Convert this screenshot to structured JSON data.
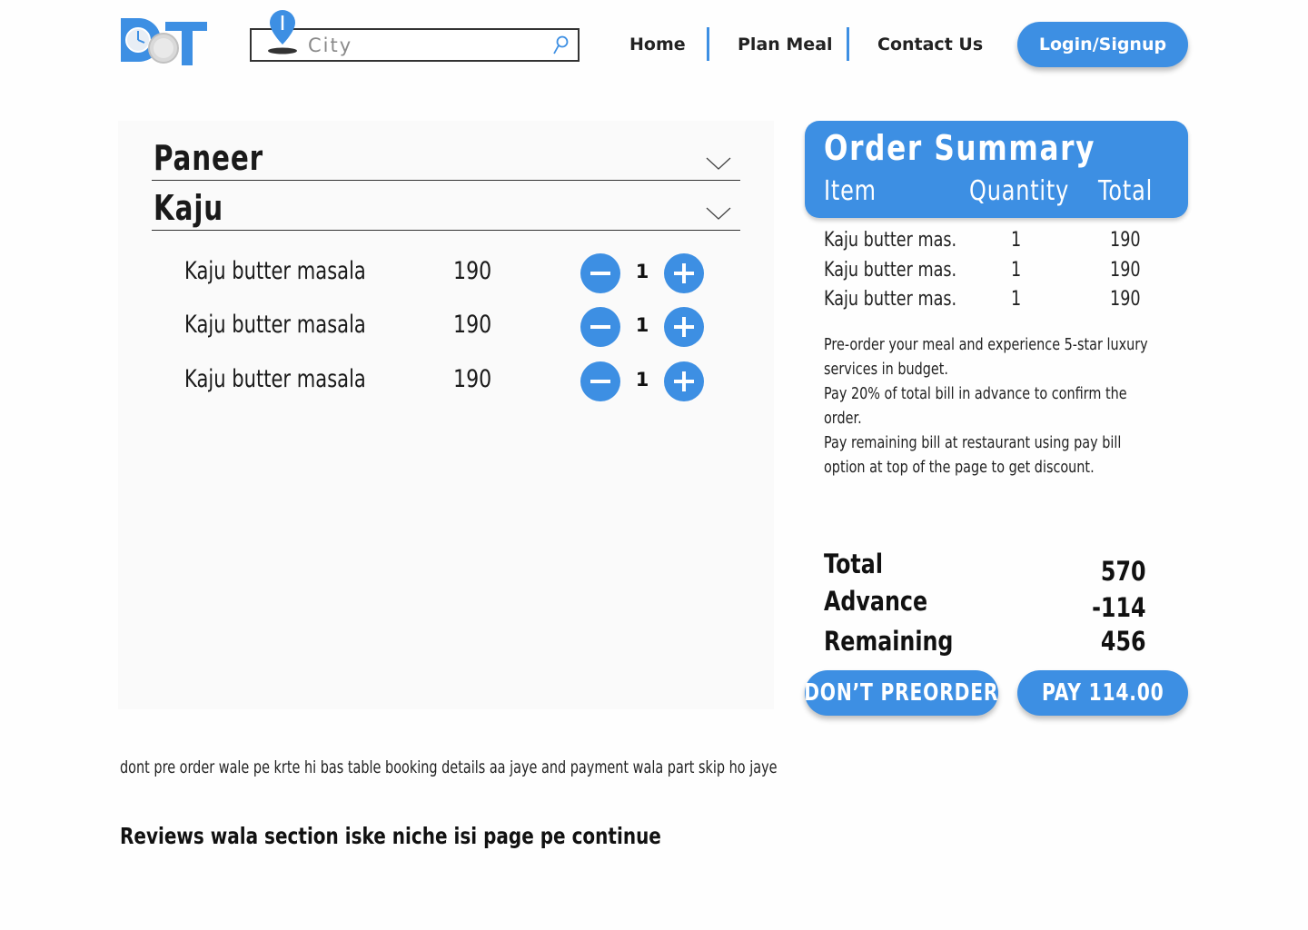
{
  "header": {
    "search": {
      "placeholder": "City",
      "value": ""
    },
    "nav": [
      {
        "label": "Home"
      },
      {
        "label": "Plan Meal"
      },
      {
        "label": "Contact Us"
      }
    ],
    "login_label": "Login/Signup"
  },
  "menu": {
    "categories": [
      {
        "label": "Paneer",
        "expanded": false
      },
      {
        "label": "Kaju",
        "expanded": true
      }
    ],
    "items": [
      {
        "name": "Kaju butter masala",
        "price": "190",
        "quantity": "1"
      },
      {
        "name": "Kaju butter masala",
        "price": "190",
        "quantity": "1"
      },
      {
        "name": "Kaju butter masala",
        "price": "190",
        "quantity": "1"
      }
    ]
  },
  "summary": {
    "title": "Order Summary",
    "columns": {
      "item": "Item",
      "quantity": "Quantity",
      "total": "Total"
    },
    "rows": [
      {
        "item": "Kaju butter mas.",
        "quantity": "1",
        "total": "190"
      },
      {
        "item": "Kaju butter mas.",
        "quantity": "1",
        "total": "190"
      },
      {
        "item": "Kaju butter mas.",
        "quantity": "1",
        "total": "190"
      }
    ],
    "notes": [
      "Pre-order your meal and experience 5-star luxury services in budget.",
      "Pay 20% of total bill in advance to confirm the order.",
      "Pay remaining bill at restaurant using pay bill option at top of the page to get discount."
    ],
    "totals": {
      "total_label": "Total",
      "total_value": "570",
      "advance_label": "Advance",
      "advance_value": "-114",
      "remaining_label": "Remaining",
      "remaining_value": "456"
    },
    "dont_preorder_label": "DON’T PREORDER",
    "pay_label": "PAY 114.00"
  },
  "footer": {
    "note": "dont pre order wale pe krte hi bas table booking details aa jaye and payment wala part skip ho jaye",
    "reviews_note": "Reviews wala section iske niche isi page pe continue"
  },
  "colors": {
    "accent": "#3d8fe3",
    "text": "#111111",
    "panel": "#fafafa"
  }
}
